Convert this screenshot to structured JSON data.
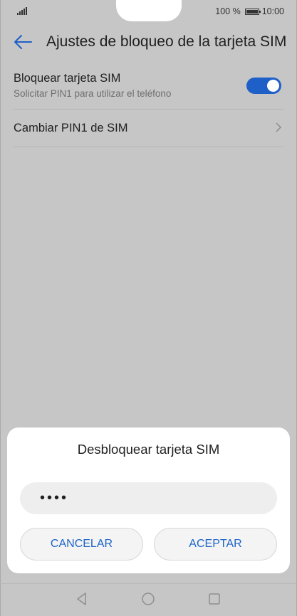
{
  "status_bar": {
    "battery_text": "100 %",
    "time": "10:00",
    "icons": [
      "signal-icon",
      "battery-icon"
    ]
  },
  "header": {
    "title": "Ajustes de bloqueo de la tarjeta SIM",
    "back_icon": "arrow-left-icon"
  },
  "settings": {
    "lock_sim": {
      "title": "Bloquear tarjeta SIM",
      "subtitle": "Solicitar PIN1 para utilizar el teléfono",
      "enabled": true
    },
    "change_pin": {
      "title": "Cambiar PIN1 de SIM",
      "icon": "chevron-right-icon"
    }
  },
  "dialog": {
    "title": "Desbloquear tarjeta SIM",
    "pin_value": "••••",
    "cancel_label": "CANCELAR",
    "accept_label": "ACEPTAR"
  },
  "nav_bar": {
    "icons": [
      "back-triangle-icon",
      "home-circle-icon",
      "recents-square-icon"
    ]
  },
  "colors": {
    "accent": "#1e5fc8",
    "overlay_background": "#c6c6c6",
    "dialog_background": "#ffffff"
  }
}
